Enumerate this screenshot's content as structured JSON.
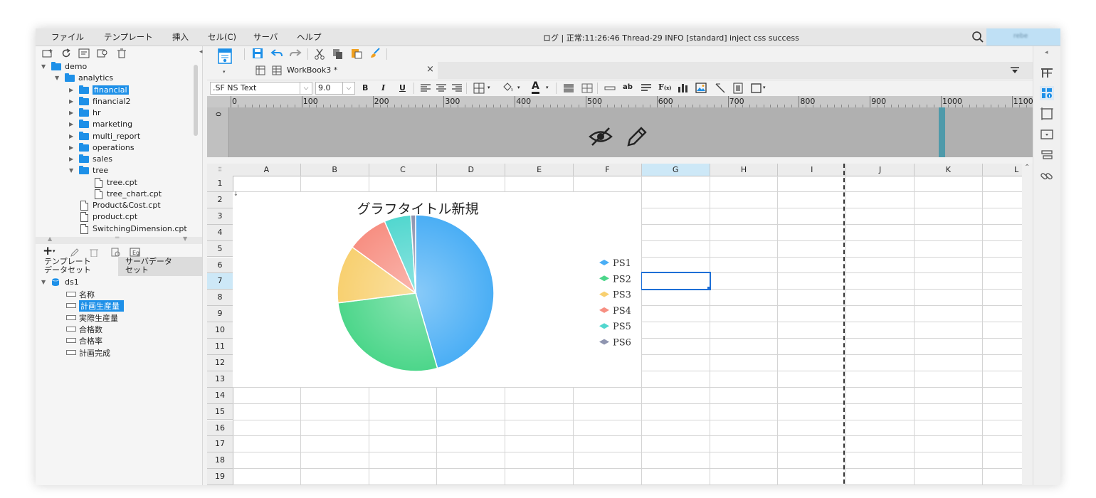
{
  "menu": [
    "ファイル",
    "テンプレート",
    "挿入",
    "セル(C)",
    "サーバ",
    "ヘルプ"
  ],
  "status": "ログ | 正常:11:26:46 Thread-29 INFO [standard] inject css success",
  "user": "rebe",
  "tree": [
    {
      "label": "demo",
      "level": 0,
      "type": "folder",
      "open": true
    },
    {
      "label": "analytics",
      "level": 1,
      "type": "folder",
      "open": true
    },
    {
      "label": "financial",
      "level": 2,
      "type": "folder",
      "selected": true
    },
    {
      "label": "financial2",
      "level": 2,
      "type": "folder"
    },
    {
      "label": "hr",
      "level": 2,
      "type": "folder"
    },
    {
      "label": "marketing",
      "level": 2,
      "type": "folder"
    },
    {
      "label": "multi_report",
      "level": 2,
      "type": "folder"
    },
    {
      "label": "operations",
      "level": 2,
      "type": "folder"
    },
    {
      "label": "sales",
      "level": 2,
      "type": "folder"
    },
    {
      "label": "tree",
      "level": 2,
      "type": "folder",
      "open": true
    },
    {
      "label": "tree.cpt",
      "level": 3,
      "type": "file"
    },
    {
      "label": "tree_chart.cpt",
      "level": 3,
      "type": "file"
    },
    {
      "label": "Product&Cost.cpt",
      "level": 2,
      "type": "file"
    },
    {
      "label": "product.cpt",
      "level": 2,
      "type": "file"
    },
    {
      "label": "SwitchingDimension.cpt",
      "level": 2,
      "type": "file"
    }
  ],
  "tabs_left": {
    "template": "テンプレート\nデータセット",
    "server": "サーバデータ\nセット"
  },
  "dataset": {
    "name": "ds1",
    "fields": [
      "名称",
      "計画生産量",
      "実際生産量",
      "合格数",
      "合格率",
      "計画完成"
    ],
    "selected_field": "計画生産量"
  },
  "workbook": {
    "tab": "WorkBook3 *"
  },
  "font": {
    "family": ".SF NS Text",
    "size": "9.0"
  },
  "ruler": [
    "0",
    "100",
    "200",
    "300",
    "400",
    "500",
    "600",
    "700",
    "800",
    "900",
    "1000",
    "1100"
  ],
  "columns": [
    "A",
    "B",
    "C",
    "D",
    "E",
    "F",
    "G",
    "H",
    "I",
    "J",
    "K",
    "L"
  ],
  "rows": [
    "1",
    "2",
    "3",
    "4",
    "5",
    "6",
    "7",
    "8",
    "9",
    "10",
    "11",
    "12",
    "13",
    "14",
    "15",
    "16",
    "17",
    "18",
    "19"
  ],
  "colors": {
    "selection": "#1e90e8",
    "header_bg": "#b0b0b0"
  },
  "chart_data": {
    "type": "pie",
    "title": "グラフタイトル新規",
    "categories": [
      "PS1",
      "PS2",
      "PS3",
      "PS4",
      "PS5",
      "PS6"
    ],
    "values": [
      45.5,
      27.5,
      12,
      8.5,
      5.5,
      1
    ],
    "colors": [
      "#4aaef5",
      "#4cd68a",
      "#f8d070",
      "#f78f82",
      "#52d7cf",
      "#8f95b0"
    ],
    "legend": "right"
  }
}
